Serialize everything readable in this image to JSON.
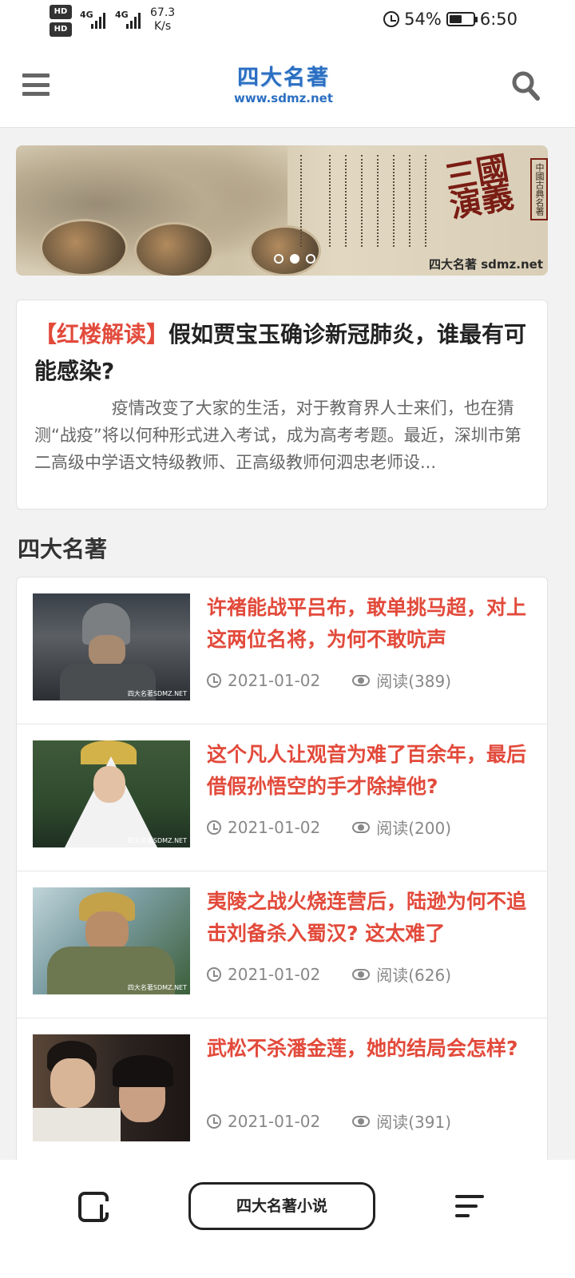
{
  "status_bar": {
    "hd1": "HD",
    "hd2": "HD",
    "network1": "4G",
    "network2": "4G",
    "speed_value": "67.3",
    "speed_unit": "K/s",
    "battery_percent": "54%",
    "battery_level": 0.54,
    "time": "6:50"
  },
  "header": {
    "logo_cn": "四大名著",
    "logo_url": "www.sdmz.net"
  },
  "banner": {
    "title": "三國演義",
    "stamp": "中國古典名著",
    "watermark": "四大名著 sdmz.net",
    "dots": [
      false,
      true,
      false
    ]
  },
  "featured": {
    "tag": "【红楼解读】",
    "title": "假如贾宝玉确诊新冠肺炎，谁最有可能感染?",
    "summary": "疫情改变了大家的生活，对于教育界人士来们，也在猜测“战疫”将以何种形式进入考试，成为高考考题。最近，深圳市第二高级中学语文特级教师、正高级教师何泗忠老师设..."
  },
  "section": {
    "title": "四大名著"
  },
  "articles": [
    {
      "title": "许褚能战平吕布，敢单挑马超，对上这两位名将，为何不敢吭声",
      "date": "2021-01-02",
      "views": "阅读(389)",
      "thumb_wm": "四大名著SDMZ.NET"
    },
    {
      "title": "这个凡人让观音为难了百余年，最后借假孙悟空的手才除掉他?",
      "date": "2021-01-02",
      "views": "阅读(200)",
      "thumb_wm": "四大名著SDMZ.NET"
    },
    {
      "title": "夷陵之战火烧连营后，陆逊为何不追击刘备杀入蜀汉? 这太难了",
      "date": "2021-01-02",
      "views": "阅读(626)",
      "thumb_wm": "四大名著SDMZ.NET"
    },
    {
      "title": "武松不杀潘金莲，她的结局会怎样?",
      "date": "2021-01-02",
      "views": "阅读(391)",
      "thumb_wm": ""
    }
  ],
  "bottom_bar": {
    "title": "四大名著小说"
  }
}
